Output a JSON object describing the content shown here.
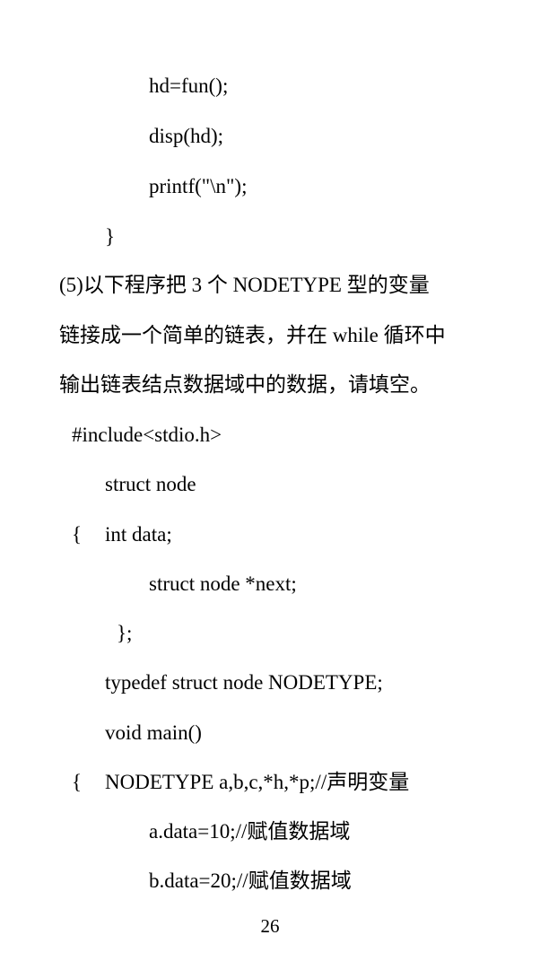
{
  "code_top": [
    "hd=fun();",
    "disp(hd);",
    "printf(\"\\n\");",
    "}"
  ],
  "question": [
    "(5)以下程序把 3 个 NODETYPE 型的变量",
    "链接成一个简单的链表，并在 while 循环中",
    "输出链表结点数据域中的数据，请填空。"
  ],
  "code": [
    "#include<stdio.h>",
    "struct node",
    "{",
    "int data;",
    "struct node *next;",
    "};",
    "typedef struct node NODETYPE;",
    "void main()",
    "{",
    "NODETYPE a,b,c,*h,*p;//声明变量",
    "a.data=10;//赋值数据域",
    "b.data=20;//赋值数据域"
  ],
  "page_number": "26"
}
